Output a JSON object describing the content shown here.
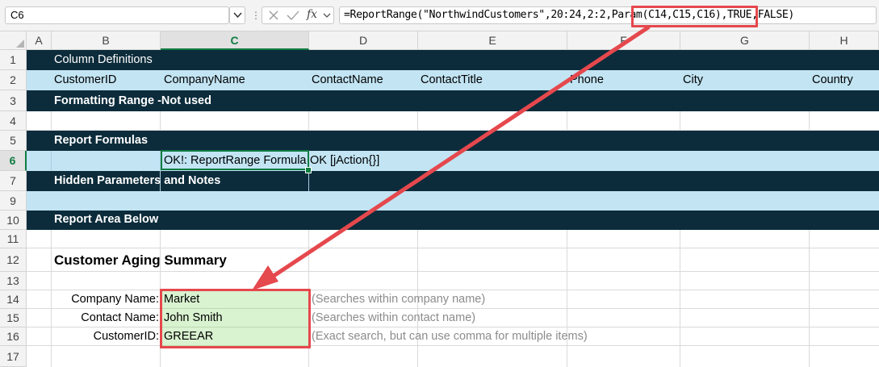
{
  "formula_bar": {
    "name_box": "C6",
    "fx_label": "fx",
    "formula_prefix": "=ReportRange(\"NorthwindCustomers\",20:24,2:2,",
    "formula_param": "Param(C14,C15,C16)",
    "formula_suffix": ",TRUE,FALSE)"
  },
  "columns": [
    "A",
    "B",
    "C",
    "D",
    "E",
    "F",
    "G",
    "H"
  ],
  "rows": [
    "1",
    "2",
    "3",
    "4",
    "5",
    "6",
    "7",
    "9",
    "10",
    "11",
    "12",
    "13",
    "14",
    "15",
    "16",
    "17"
  ],
  "sheet": {
    "r1_b": "Column Definitions",
    "r2": {
      "b": "CustomerID",
      "c": "CompanyName",
      "d": "ContactName",
      "e": "ContactTitle",
      "f": "Phone",
      "g": "City",
      "h": "Country"
    },
    "r3_b": "Formatting Range -Not used",
    "r5_b": "Report Formulas",
    "r6_c": "OK!: ReportRange Formula",
    "r6_d": "OK [jAction{}]",
    "r7_b": "Hidden Parameters and Notes",
    "r10_b": "Report Area Below",
    "r12_b": "Customer Aging Summary",
    "params": [
      {
        "label": "Company Name:",
        "value": "Market",
        "hint": "(Searches within company name)"
      },
      {
        "label": "Contact Name:",
        "value": "John Smith",
        "hint": "(Searches within contact name)"
      },
      {
        "label": "CustomerID:",
        "value": "GREEAR",
        "hint": "(Exact search, but can use comma for multiple items)"
      }
    ]
  },
  "colors": {
    "dark_band": "#0c2c3b",
    "light_band": "#c2e4f3",
    "param_fill": "#d9f2d0",
    "highlight_red": "#e5484d",
    "excel_green": "#107c41"
  }
}
